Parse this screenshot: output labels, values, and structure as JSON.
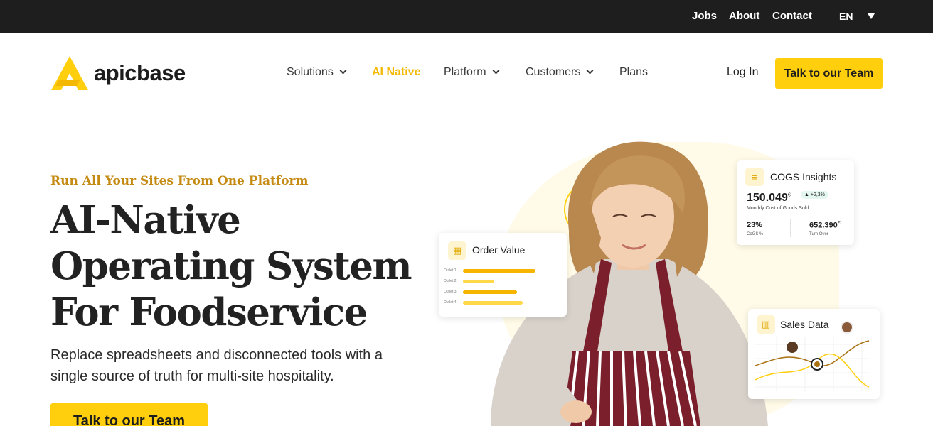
{
  "topbar": {
    "links": [
      "Jobs",
      "About",
      "Contact"
    ],
    "language": "EN"
  },
  "header": {
    "logo_text": "apicbase",
    "nav": [
      {
        "label": "Solutions",
        "has_dropdown": true
      },
      {
        "label": "AI Native",
        "active": true
      },
      {
        "label": "Platform",
        "has_dropdown": true
      },
      {
        "label": "Customers",
        "has_dropdown": true
      },
      {
        "label": "Plans"
      }
    ],
    "login_label": "Log In",
    "cta_label": "Talk to our Team"
  },
  "hero": {
    "eyebrow": "Run All Your Sites From One Platform",
    "headline_lines": [
      "AI-Native",
      "Operating System",
      "For Foodservice"
    ],
    "subtitle": "Replace spreadsheets and disconnected tools with a single source of truth for multi-site hospitality.",
    "cta_label": "Talk to our Team"
  },
  "cards": {
    "order_value": {
      "title": "Order Value",
      "outlets": [
        {
          "label": "Outlet 1",
          "share": 0.85
        },
        {
          "label": "Outlet 2",
          "share": 0.37
        },
        {
          "label": "Outlet 3",
          "share": 0.63
        },
        {
          "label": "Outlet 4",
          "share": 0.7
        }
      ]
    },
    "cogs": {
      "title": "COGS Insights",
      "value": "150.049",
      "currency": "€",
      "change": "+2,3%",
      "caption": "Monthly Cost of Goods Sold",
      "cogs_pct": "23%",
      "cogs_pct_label": "CoGS %",
      "turnover": "652.390",
      "turnover_label": "Turn Over"
    },
    "sales": {
      "title": "Sales Data"
    }
  },
  "colors": {
    "accent": "#ffcf0d",
    "eyebrow": "#c48a12",
    "topbar": "#1e1e1e"
  }
}
